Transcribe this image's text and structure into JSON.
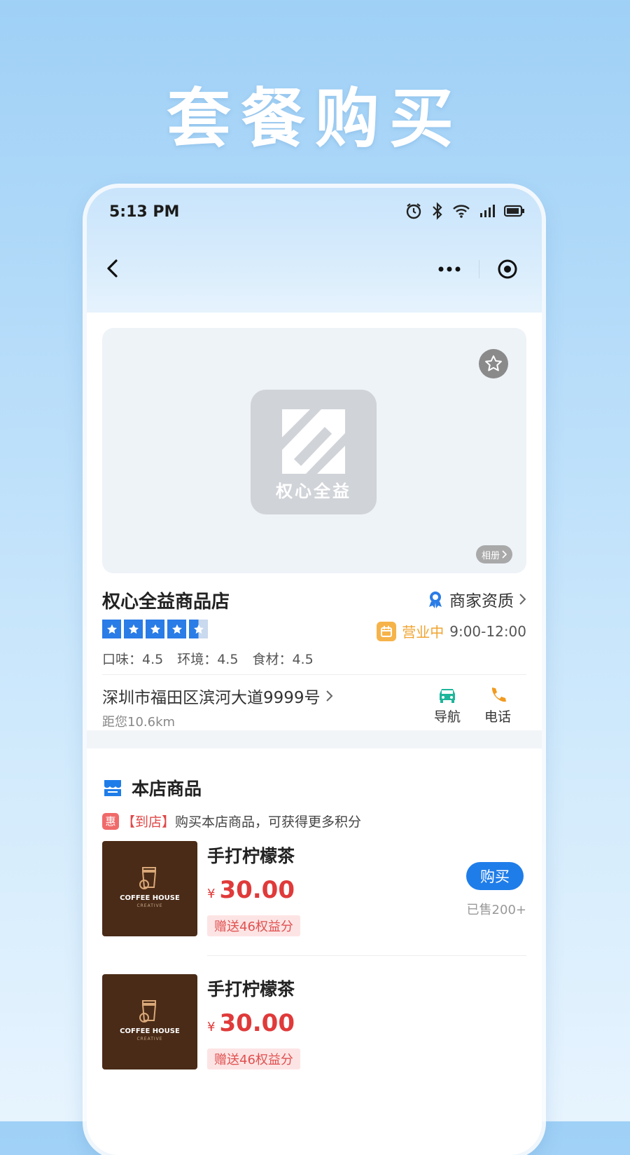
{
  "headline": "套餐购买",
  "status_bar": {
    "time": "5:13 PM"
  },
  "store": {
    "name": "权心全益商品店",
    "logo_text": "权心全益",
    "album_label": "相册",
    "qualification": "商家资质",
    "rating_stars": 4.5,
    "status": "营业中",
    "hours": "9:00-12:00",
    "ratings": [
      "口味：4.5",
      "环境：4.5",
      "食材：4.5"
    ],
    "address": "深圳市福田区滨河大道9999号",
    "distance": "距您10.6km",
    "actions": {
      "navigate": "导航",
      "call": "电话"
    }
  },
  "section": {
    "title": "本店商品",
    "promo_badge": "惠",
    "promo_tag": "【到店】",
    "promo_text": "购买本店商品，可获得更多积分"
  },
  "products": [
    {
      "name": "手打柠檬茶",
      "currency": "¥",
      "price": "30.00",
      "gift": "赠送46权益分",
      "buy_label": "购买",
      "sold": "已售200+",
      "thumb_brand": "COFFEE HOUSE",
      "thumb_sub": "CREATIVE"
    },
    {
      "name": "手打柠檬茶",
      "currency": "¥",
      "price": "30.00",
      "gift": "赠送46权益分",
      "thumb_brand": "COFFEE HOUSE",
      "thumb_sub": "CREATIVE"
    }
  ],
  "colors": {
    "accent": "#1f7de9",
    "price": "#e03a3a",
    "open": "#f0a430"
  },
  "icons": [
    "alarm-icon",
    "bluetooth-icon",
    "wifi-icon",
    "signal-icon",
    "battery-icon",
    "back-icon",
    "more-icon",
    "close-miniapp-icon",
    "favorite-star-icon",
    "qualification-icon",
    "open-status-icon",
    "car-icon",
    "phone-icon",
    "shop-icon"
  ]
}
